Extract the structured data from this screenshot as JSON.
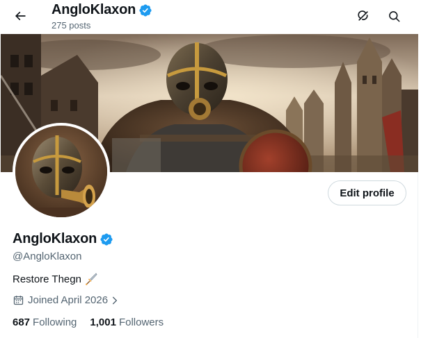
{
  "header": {
    "name": "AngloKlaxon",
    "post_count": "275 posts",
    "back_icon": "arrow-left-icon",
    "grok_icon": "grok-icon",
    "search_icon": "search-icon"
  },
  "profile": {
    "display_name": "AngloKlaxon",
    "verified": true,
    "handle": "@AngloKlaxon",
    "bio_text": "Restore Thegn",
    "bio_emoji": "dagger-emoji",
    "joined": "Joined April 2026",
    "following_count": "687",
    "following_label": "Following",
    "followers_count": "1,001",
    "followers_label": "Followers"
  },
  "actions": {
    "edit_profile": "Edit profile"
  },
  "colors": {
    "verified_blue": "#1d9bf0",
    "text_primary": "#0f1419",
    "text_secondary": "#536471",
    "border": "#cfd9de"
  }
}
